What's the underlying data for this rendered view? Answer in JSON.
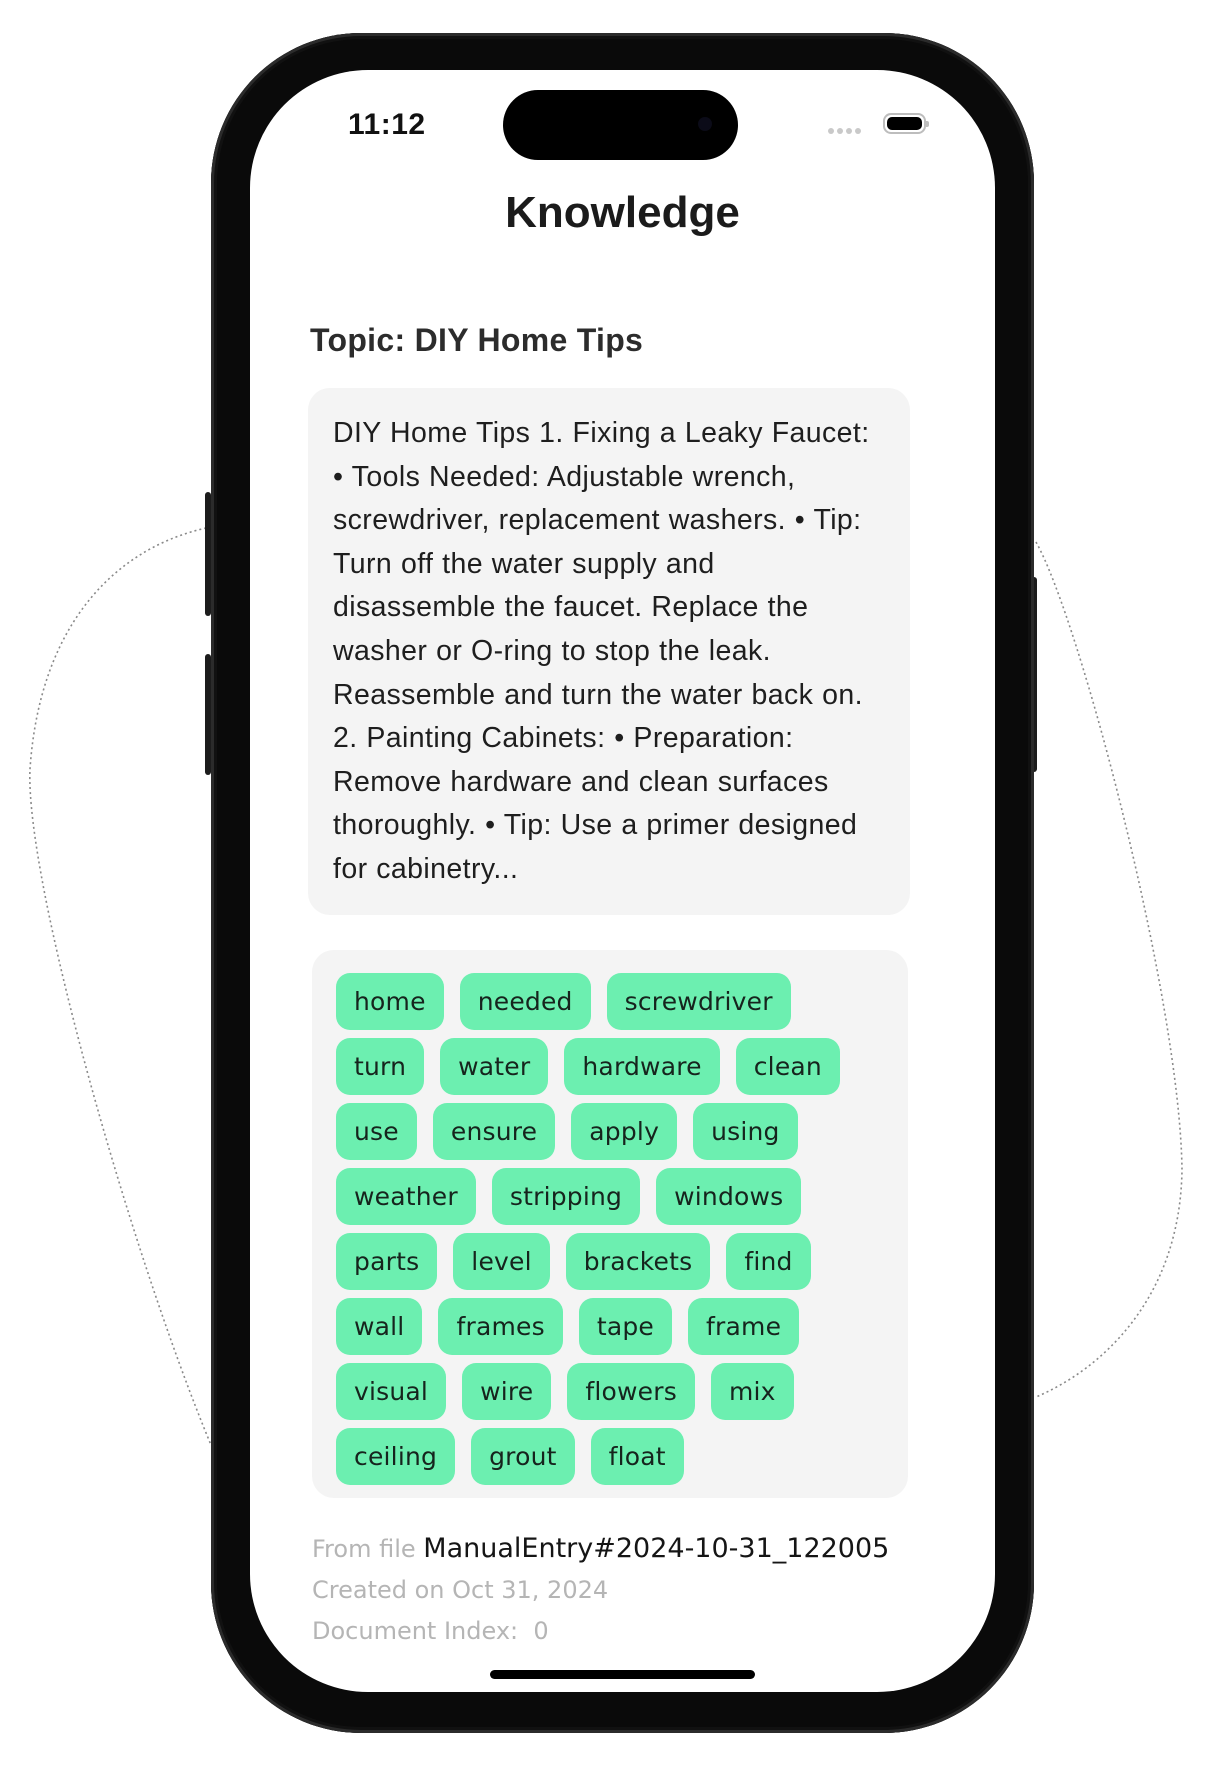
{
  "status_bar": {
    "time": "11:12",
    "signal_icon": "signal-dots-icon",
    "battery_icon": "battery-full-icon"
  },
  "header": {
    "title": "Knowledge"
  },
  "topic": {
    "label": "Topic: DIY Home Tips"
  },
  "content": {
    "text": "DIY Home Tips 1. Fixing a Leaky Faucet: • Tools Needed: Adjustable wrench, screwdriver, replacement washers. • Tip: Turn off the water supply and disassemble the faucet. Replace the washer or O-ring to stop the leak. Reassemble and turn the water back on. 2. Painting Cabinets: • Preparation: Remove hardware and clean surfaces thoroughly. • Tip: Use a primer designed for cabinetry..."
  },
  "tags": [
    "home",
    "needed",
    "screwdriver",
    "turn",
    "water",
    "hardware",
    "clean",
    "use",
    "ensure",
    "apply",
    "using",
    "weather",
    "stripping",
    "windows",
    "parts",
    "level",
    "brackets",
    "find",
    "wall",
    "frames",
    "tape",
    "frame",
    "visual",
    "wire",
    "flowers",
    "mix",
    "ceiling",
    "grout",
    "float"
  ],
  "footer": {
    "from_file_label": "From file",
    "file_name": "ManualEntry#2024-10-31_122005",
    "created_on": "Created on Oct 31, 2024",
    "document_index_label": "Document Index:",
    "document_index_value": "0"
  },
  "colors": {
    "tag_background": "#6cefb0",
    "card_background": "#f4f4f4",
    "muted_text": "#b5b5b5"
  }
}
